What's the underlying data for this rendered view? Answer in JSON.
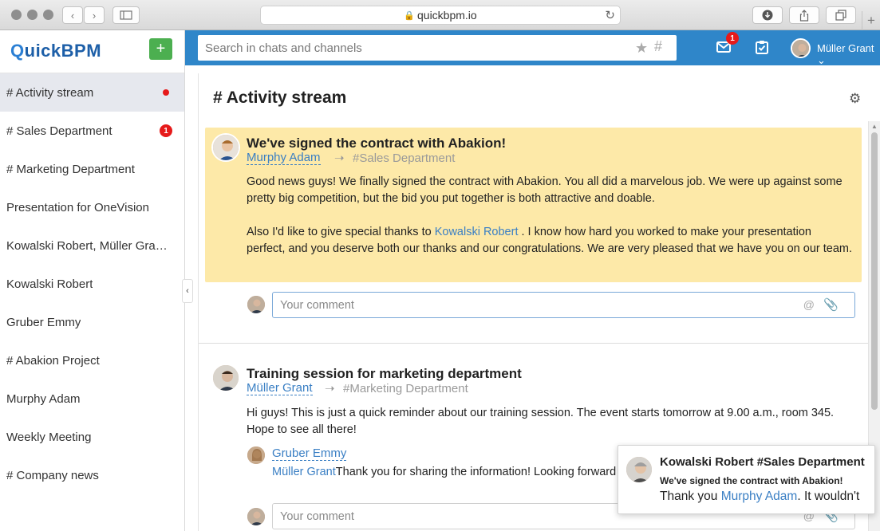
{
  "browser": {
    "url": "quickbpm.io"
  },
  "app": {
    "logo_first": "Q",
    "logo_rest": "uickBPM",
    "add_label": "+"
  },
  "sidebar": {
    "items": [
      {
        "label": "# Activity stream",
        "indicator": "dot"
      },
      {
        "label": "# Sales Department",
        "badge": "1"
      },
      {
        "label": "# Marketing Department"
      },
      {
        "label": "Presentation for OneVision"
      },
      {
        "label": "Kowalski Robert, Müller Grant, Murphy Adam"
      },
      {
        "label": "Kowalski Robert"
      },
      {
        "label": "Gruber Emmy"
      },
      {
        "label": "# Abakion Project"
      },
      {
        "label": "Murphy Adam"
      },
      {
        "label": "Weekly Meeting"
      },
      {
        "label": "# Company news"
      }
    ]
  },
  "topbar": {
    "search_placeholder": "Search in chats and channels",
    "star_icon": "★",
    "hash_icon": "#",
    "mail_badge": "1",
    "user_name": "Müller Grant"
  },
  "main": {
    "title": "# Activity stream",
    "posts": [
      {
        "title": "We've signed the contract with Abakion!",
        "author": "Murphy Adam",
        "channel": "#Sales Department",
        "para1": "Good news guys! We finally signed the contract with Abakion. You all did a marvelous job. We were up against some pretty big competition, but the bid you put together is both attractive and doable.",
        "para2_pre": "Also I'd like to give special thanks to ",
        "para2_link": "Kowalski Robert",
        "para2_post": " . I know how hard you worked to make your presentation perfect, and you deserve both our thanks and our congratulations. We are very pleased that we have you on our team.",
        "comment_placeholder": "Your comment"
      },
      {
        "title": "Training session for marketing department",
        "author": "Müller Grant",
        "channel": "#Marketing Department",
        "body": "Hi guys! This is just a quick reminder about our training session. The event starts tomorrow at 9.00 a.m., room 345. Hope to see all there!",
        "reply_author": "Gruber Emmy",
        "reply_mention": "Müller Grant",
        "reply_text": "Thank you for sharing the information! Looking forward to it.",
        "comment_placeholder": "Your comment"
      }
    ]
  },
  "notification": {
    "title": "Kowalski Robert #Sales Department",
    "subtitle": "We've signed the contract with Abakion!",
    "body_pre": "Thank you ",
    "body_link": "Murphy Adam",
    "body_post": ". It wouldn't"
  },
  "colors": {
    "topbar": "#2f86c9",
    "highlight_post": "#fde9a8",
    "badge": "#e61a1a",
    "add_button": "#4caf50",
    "link": "#3a7fc4"
  }
}
